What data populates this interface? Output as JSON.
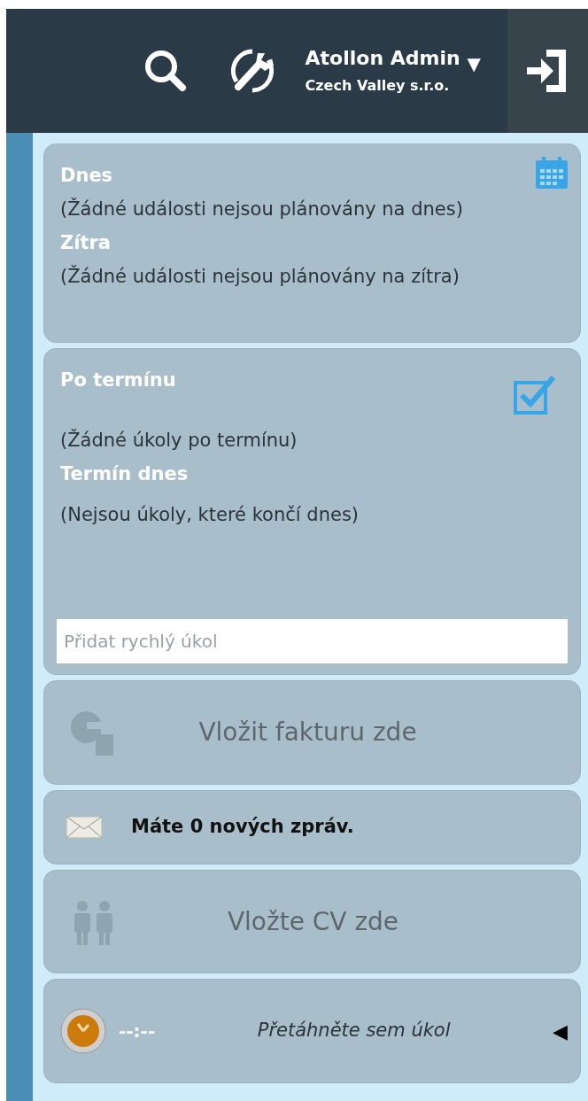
{
  "header": {
    "user_name": "Atollon Admin",
    "company": "Czech Valley s.r.o.",
    "dropdown_symbol": "▼"
  },
  "calendar": {
    "sections": [
      {
        "title": "Dnes",
        "text": "(Žádné události nejsou plánovány na dnes)"
      },
      {
        "title": "Zítra",
        "text": "(Žádné události nejsou plánovány na zítra)"
      }
    ]
  },
  "tasks": {
    "sections": [
      {
        "title": "Po termínu",
        "text": "(Žádné úkoly po termínu)"
      },
      {
        "title": "Termín dnes",
        "text": "(Nejsou úkoly, které končí dnes)"
      }
    ],
    "quick_task": {
      "placeholder": "Přidat rychlý úkol"
    }
  },
  "invoice_drop": {
    "label": "Vložit fakturu zde"
  },
  "messages": {
    "text": "Máte 0 nových zpráv."
  },
  "cv_drop": {
    "label": "Vložte CV zde"
  },
  "timer": {
    "time": "--:--",
    "label": "Přetáhněte sem úkol",
    "arrow": "◀"
  }
}
